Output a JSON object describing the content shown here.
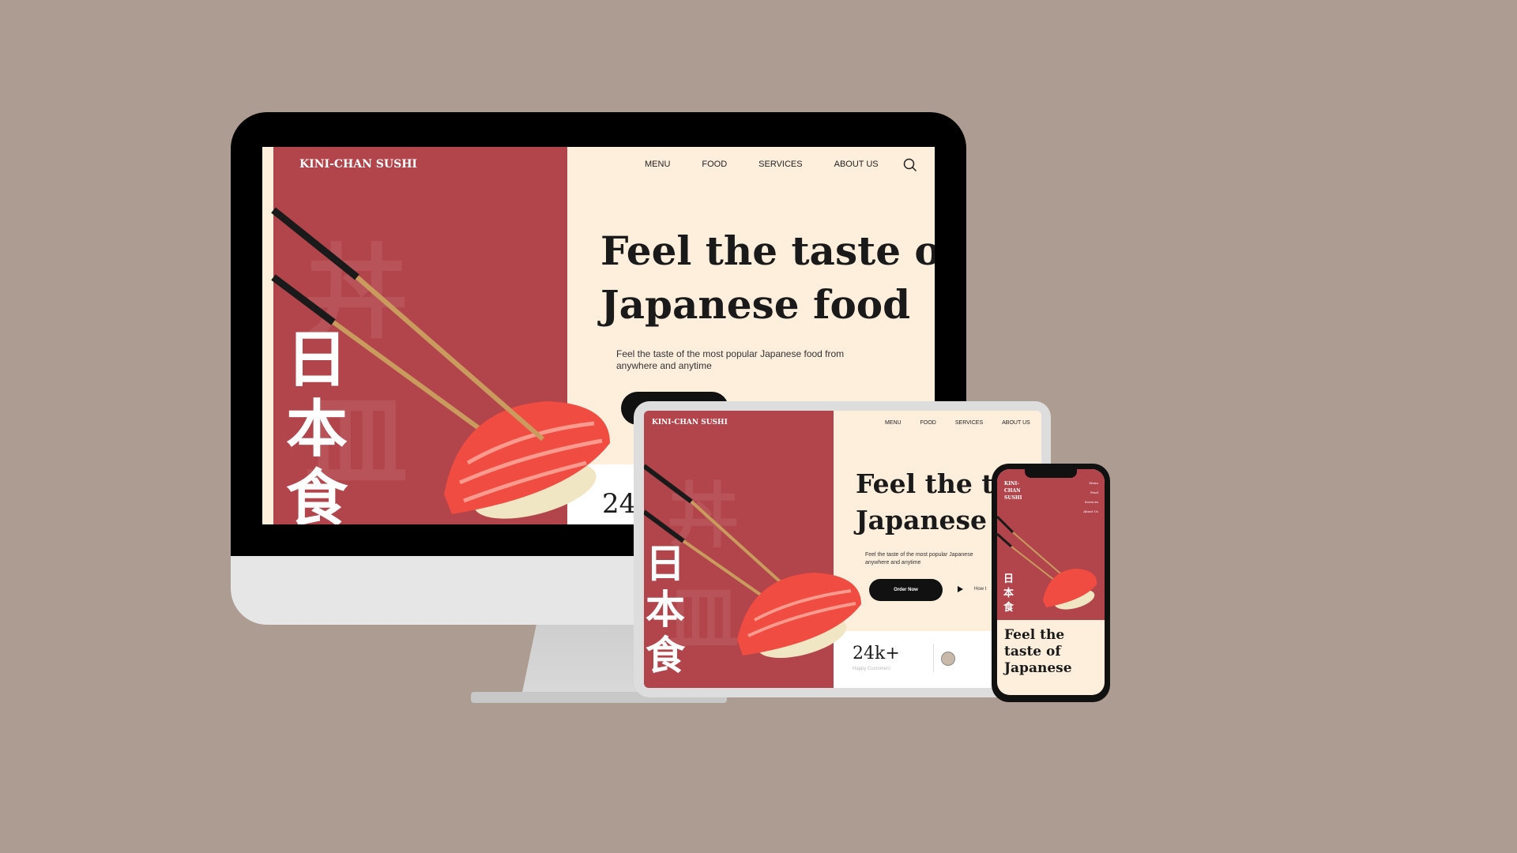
{
  "brand": "KINI-CHAN SUSHI",
  "colors": {
    "background": "#ad9c91",
    "panel_red": "#b1454b",
    "cream": "#feeedc",
    "dark": "#111111"
  },
  "desktop": {
    "nav": [
      "MENU",
      "FOOD",
      "SERVICES",
      "ABOUT US"
    ],
    "hero_line1": "Feel the taste of",
    "hero_line2": "Japanese food",
    "sub1": "Feel the taste of the most popular Japanese food from",
    "sub2": "anywhere and anytime",
    "kanji": [
      "日",
      "本",
      "食"
    ],
    "watermark": "丼 皿",
    "stat_partial": "24"
  },
  "tablet": {
    "nav": [
      "MENU",
      "FOOD",
      "SERVICES",
      "ABOUT US"
    ],
    "hero_line1": "Feel the tas",
    "hero_line2": "Japanese fo",
    "sub1": "Feel the taste of the most popular Japanese",
    "sub2": "anywhere and anytime",
    "button": "Order Now",
    "howto": "How t",
    "stat": "24k+",
    "stat_label": "Happy Customers",
    "kanji": [
      "日",
      "本",
      "食"
    ]
  },
  "phone": {
    "brand_lines": [
      "KINI-",
      "CHAN",
      "SUSHI"
    ],
    "nav": [
      "Menu",
      "Food",
      "Services",
      "About Us"
    ],
    "hero": [
      "Feel the",
      "taste of",
      "Japanese"
    ],
    "kanji": [
      "日",
      "本",
      "食"
    ]
  },
  "icons": {
    "search": "search-icon",
    "play": "play-icon",
    "avatar": "avatar"
  }
}
